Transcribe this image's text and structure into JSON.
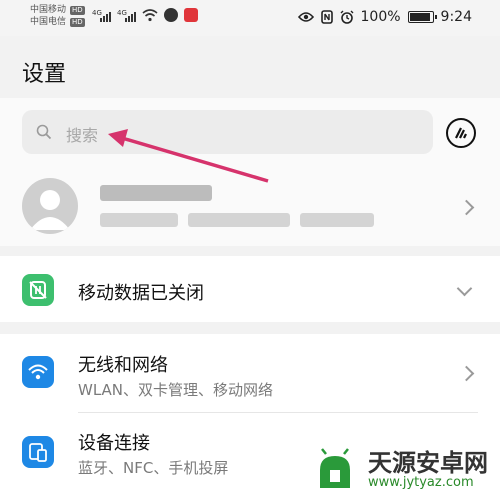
{
  "status_bar": {
    "carrier1": "中国移动",
    "carrier2": "中国电信",
    "hd": "HD",
    "network": "4G",
    "battery": "100%",
    "time": "9:24"
  },
  "page_title": "设置",
  "search": {
    "placeholder": "搜索"
  },
  "items": [
    {
      "title": "移动数据已关闭"
    },
    {
      "title": "无线和网络",
      "subtitle": "WLAN、双卡管理、移动网络"
    },
    {
      "title": "设备连接",
      "subtitle": "蓝牙、NFC、手机投屏"
    }
  ],
  "watermark": {
    "name": "天源安卓网",
    "url": "www.jytyaz.com"
  },
  "colors": {
    "accent": "#1e88e5",
    "mobile_data": "#3dbf6e",
    "arrow": "#d6336c"
  }
}
